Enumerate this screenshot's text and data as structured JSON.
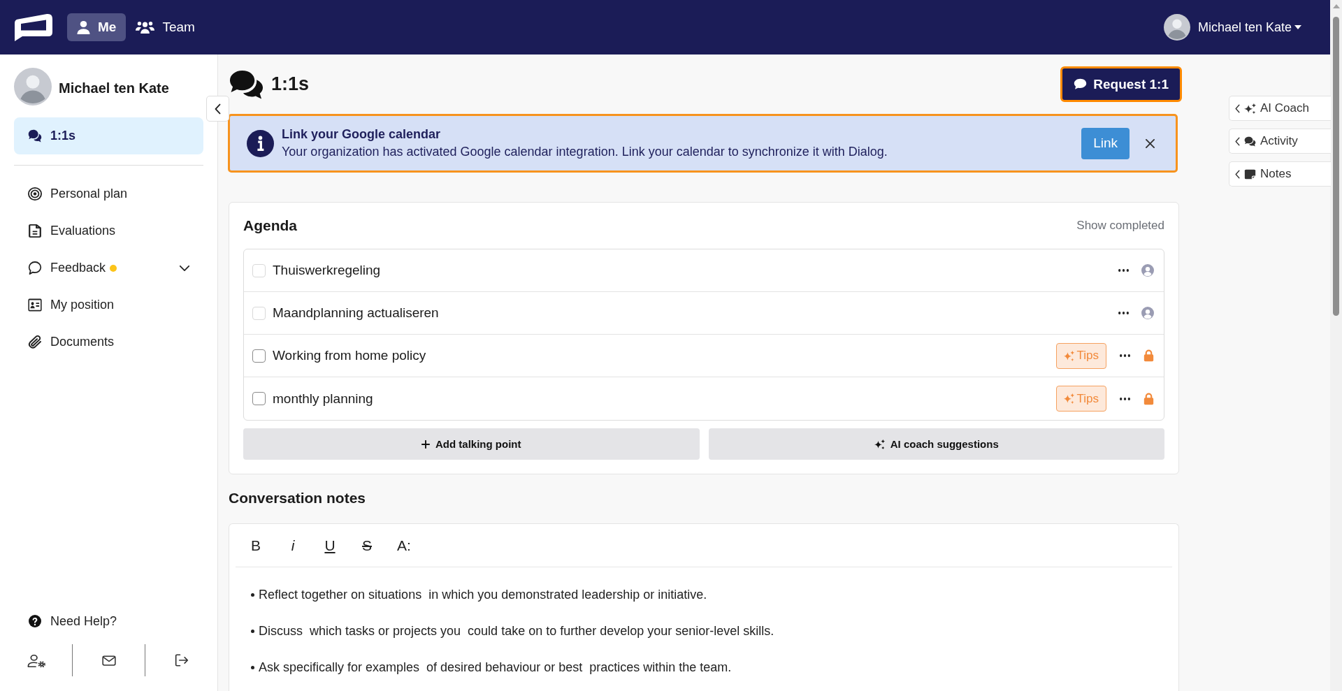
{
  "top_bar": {
    "nav": [
      {
        "label": "Me",
        "selected": true
      },
      {
        "label": "Team",
        "selected": false
      }
    ],
    "user_name": "Michael ten Kate"
  },
  "sidebar": {
    "profile_name": "Michael ten Kate",
    "sections": [
      {
        "items": [
          {
            "label": "1:1s",
            "selected": true,
            "unread": false,
            "expandable": false
          }
        ]
      },
      {
        "items": [
          {
            "label": "Personal plan",
            "selected": false,
            "unread": false,
            "expandable": false
          },
          {
            "label": "Evaluations",
            "selected": false,
            "unread": false,
            "expandable": false
          },
          {
            "label": "Feedback",
            "selected": false,
            "unread": true,
            "expandable": true
          },
          {
            "label": "My position",
            "selected": false,
            "unread": false,
            "expandable": false
          },
          {
            "label": "Documents",
            "selected": false,
            "unread": false,
            "expandable": false
          }
        ]
      }
    ],
    "help": "Need Help?"
  },
  "header": {
    "title": "1:1s",
    "request_button": {
      "label": "Request 1:1",
      "highlighted": true
    }
  },
  "banner": {
    "title": "Link your Google calendar",
    "text": "Your organization has activated Google calendar integration. Link your calendar to synchronize it with Dialog.",
    "button": "Link",
    "highlighted": true
  },
  "agenda": {
    "title": "Agenda",
    "show_completed": "Show completed",
    "items": [
      {
        "label": "Thuiswerkregeling",
        "checked": false,
        "disabled": true,
        "kind": "assigned"
      },
      {
        "label": "Maandplanning actualiseren",
        "checked": false,
        "disabled": true,
        "kind": "assigned"
      },
      {
        "label": "Working from home policy",
        "checked": false,
        "disabled": false,
        "kind": "private",
        "tips": "Tips"
      },
      {
        "label": "monthly planning",
        "checked": false,
        "disabled": false,
        "kind": "private",
        "tips": "Tips"
      }
    ],
    "buttons": [
      {
        "label": "Add talking point",
        "kind": "add"
      },
      {
        "label": "AI coach suggestions",
        "kind": "ai"
      }
    ]
  },
  "notes": {
    "title": "Conversation notes",
    "toolbar": [
      {
        "label": "B",
        "kind": "bold"
      },
      {
        "label": "i",
        "kind": "italic"
      },
      {
        "label": "U",
        "kind": "underline"
      },
      {
        "label": "S",
        "kind": "strike"
      },
      {
        "label": "A:",
        "kind": "size"
      }
    ],
    "bullets": [
      "Reflect together on situations  in which you demonstrated leadership or initiative.",
      "Discuss  which tasks or projects you  could take on to further develop your senior-level skills.",
      "Ask specifically for examples  of desired behaviour or best  practices within the team."
    ]
  },
  "side_panel": {
    "tabs": [
      {
        "label": "AI Coach"
      },
      {
        "label": "Activity"
      },
      {
        "label": "Notes"
      }
    ]
  }
}
